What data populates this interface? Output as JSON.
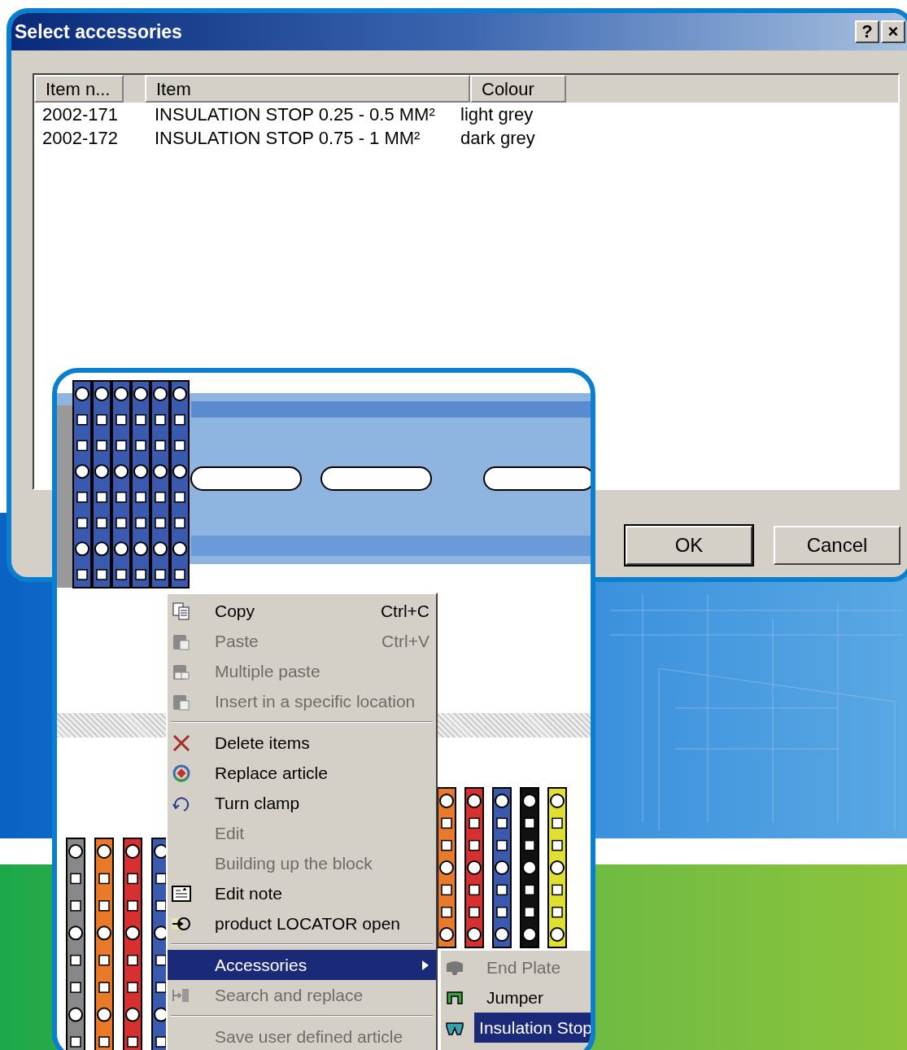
{
  "dialog": {
    "title": "Select accessories",
    "title_buttons": [
      "?",
      "×"
    ],
    "columns": [
      "Item n...",
      "Item",
      "Colour"
    ],
    "rows": [
      [
        "2002-171",
        "INSULATION STOP 0.25 - 0.5 MM²",
        "light grey"
      ],
      [
        "2002-172",
        "INSULATION STOP 0.75 - 1 MM²",
        "dark grey"
      ]
    ],
    "buttons": [
      "OK",
      "Cancel"
    ]
  },
  "context_menu": {
    "items": [
      {
        "kind": "item",
        "label": "Copy",
        "shortcut": "Ctrl+C",
        "disabled": false,
        "selected": false,
        "submenu": false
      },
      {
        "kind": "item",
        "label": "Paste",
        "shortcut": "Ctrl+V",
        "disabled": true,
        "selected": false,
        "submenu": false
      },
      {
        "kind": "item",
        "label": "Multiple paste",
        "disabled": true,
        "selected": false,
        "submenu": false
      },
      {
        "kind": "item",
        "label": "Insert in a specific location",
        "disabled": true,
        "selected": false,
        "submenu": false
      },
      {
        "kind": "separator"
      },
      {
        "kind": "item",
        "label": "Delete items",
        "disabled": false,
        "selected": false,
        "submenu": false
      },
      {
        "kind": "item",
        "label": "Replace article",
        "disabled": false,
        "selected": false,
        "submenu": false
      },
      {
        "kind": "item",
        "label": "Turn clamp",
        "disabled": false,
        "selected": false,
        "submenu": false
      },
      {
        "kind": "item",
        "label": "Edit",
        "disabled": true,
        "selected": false,
        "submenu": false
      },
      {
        "kind": "item",
        "label": "Building up the block",
        "disabled": true,
        "selected": false,
        "submenu": false
      },
      {
        "kind": "item",
        "label": "Edit note",
        "disabled": false,
        "selected": false,
        "submenu": false
      },
      {
        "kind": "item",
        "label": "product LOCATOR open",
        "disabled": false,
        "selected": false,
        "submenu": false
      },
      {
        "kind": "separator"
      },
      {
        "kind": "item",
        "label": "Accessories",
        "disabled": false,
        "selected": true,
        "submenu": true
      },
      {
        "kind": "item",
        "label": "Search and replace",
        "disabled": true,
        "selected": false,
        "submenu": false
      },
      {
        "kind": "separator"
      },
      {
        "kind": "item",
        "label": "Save user defined article",
        "disabled": true,
        "selected": false,
        "submenu": false
      }
    ]
  },
  "submenu": {
    "items": [
      {
        "label": "End Plate",
        "disabled": true,
        "selected": false
      },
      {
        "label": "Jumper",
        "disabled": false,
        "selected": false
      },
      {
        "label": "Insulation Stop",
        "disabled": false,
        "selected": true
      }
    ]
  }
}
